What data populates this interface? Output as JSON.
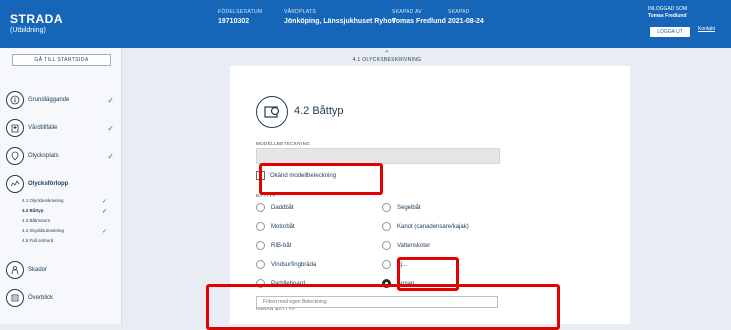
{
  "app": {
    "name": "STRADA",
    "subtitle": "(Utbildning)"
  },
  "header": {
    "fields": [
      {
        "label": "FÖDELSEDATUM",
        "value": "19710302"
      },
      {
        "label": "VÅRDPLATS",
        "value": "Jönköping, Länssjukhuset Ryhov"
      },
      {
        "label": "SKAPAD AV",
        "value": "Tomas Fredlund"
      },
      {
        "label": "SKAPAD",
        "value": "2021-08-24"
      }
    ],
    "user_label": "INLOGGAD SOM",
    "user_name": "Tomas Fredlund",
    "logout_label": "LOGGA UT",
    "contact_label": "Kontakt"
  },
  "sidebar": {
    "back_label": "GÅ TILL STARTSIDA",
    "items": [
      {
        "label": "Grundläggande",
        "done": "✓"
      },
      {
        "label": "Vårdtillfälle",
        "done": "✓"
      },
      {
        "label": "Olycksplats",
        "done": "✓"
      },
      {
        "label": "Olycksförlopp",
        "done": ""
      },
      {
        "label": "Skador",
        "done": ""
      },
      {
        "label": "Överblick",
        "done": ""
      }
    ],
    "subitems": [
      {
        "label": "4.1 Olyckbeskrivning",
        "done": "✓"
      },
      {
        "label": "4.2 Båttyp",
        "done": "✓"
      },
      {
        "label": "4.3 Båtmotorn",
        "done": ""
      },
      {
        "label": "4.4 Skyddsutrustning",
        "done": "✓"
      },
      {
        "label": "4.5 Fall ombord",
        "done": ""
      }
    ]
  },
  "main": {
    "prev_section": "4.1 OLYCKSBESKRIVNING",
    "section_title": "4.2 Båttyp",
    "model_label": "MODELLBETECKNING",
    "unknown_model_label": "Okänd modellbeteckning",
    "boat_type_label": "BÅTTYP",
    "radios": [
      {
        "label": "Daddbåt",
        "selected": false
      },
      {
        "label": "Segelbåt",
        "selected": false
      },
      {
        "label": "Motorbåt",
        "selected": false
      },
      {
        "label": "Kanot (canadensare/kajak)",
        "selected": false
      },
      {
        "label": "RIB-båt",
        "selected": false
      },
      {
        "label": "Vattenskoter",
        "selected": false
      },
      {
        "label": "Vindsurfingbräda",
        "selected": false
      },
      {
        "label": "Ej...",
        "selected": false
      },
      {
        "label": "Paddleboard",
        "selected": false
      },
      {
        "label": "Annan",
        "selected": true
      }
    ],
    "other_boat_label": "ANNAN BÅTTYP",
    "other_boat_placeholder": "Fritext med egen Beteckning"
  },
  "colors": {
    "header_bg": "#1565b8",
    "highlight": "#e30000",
    "check": "#1d6fd1"
  }
}
